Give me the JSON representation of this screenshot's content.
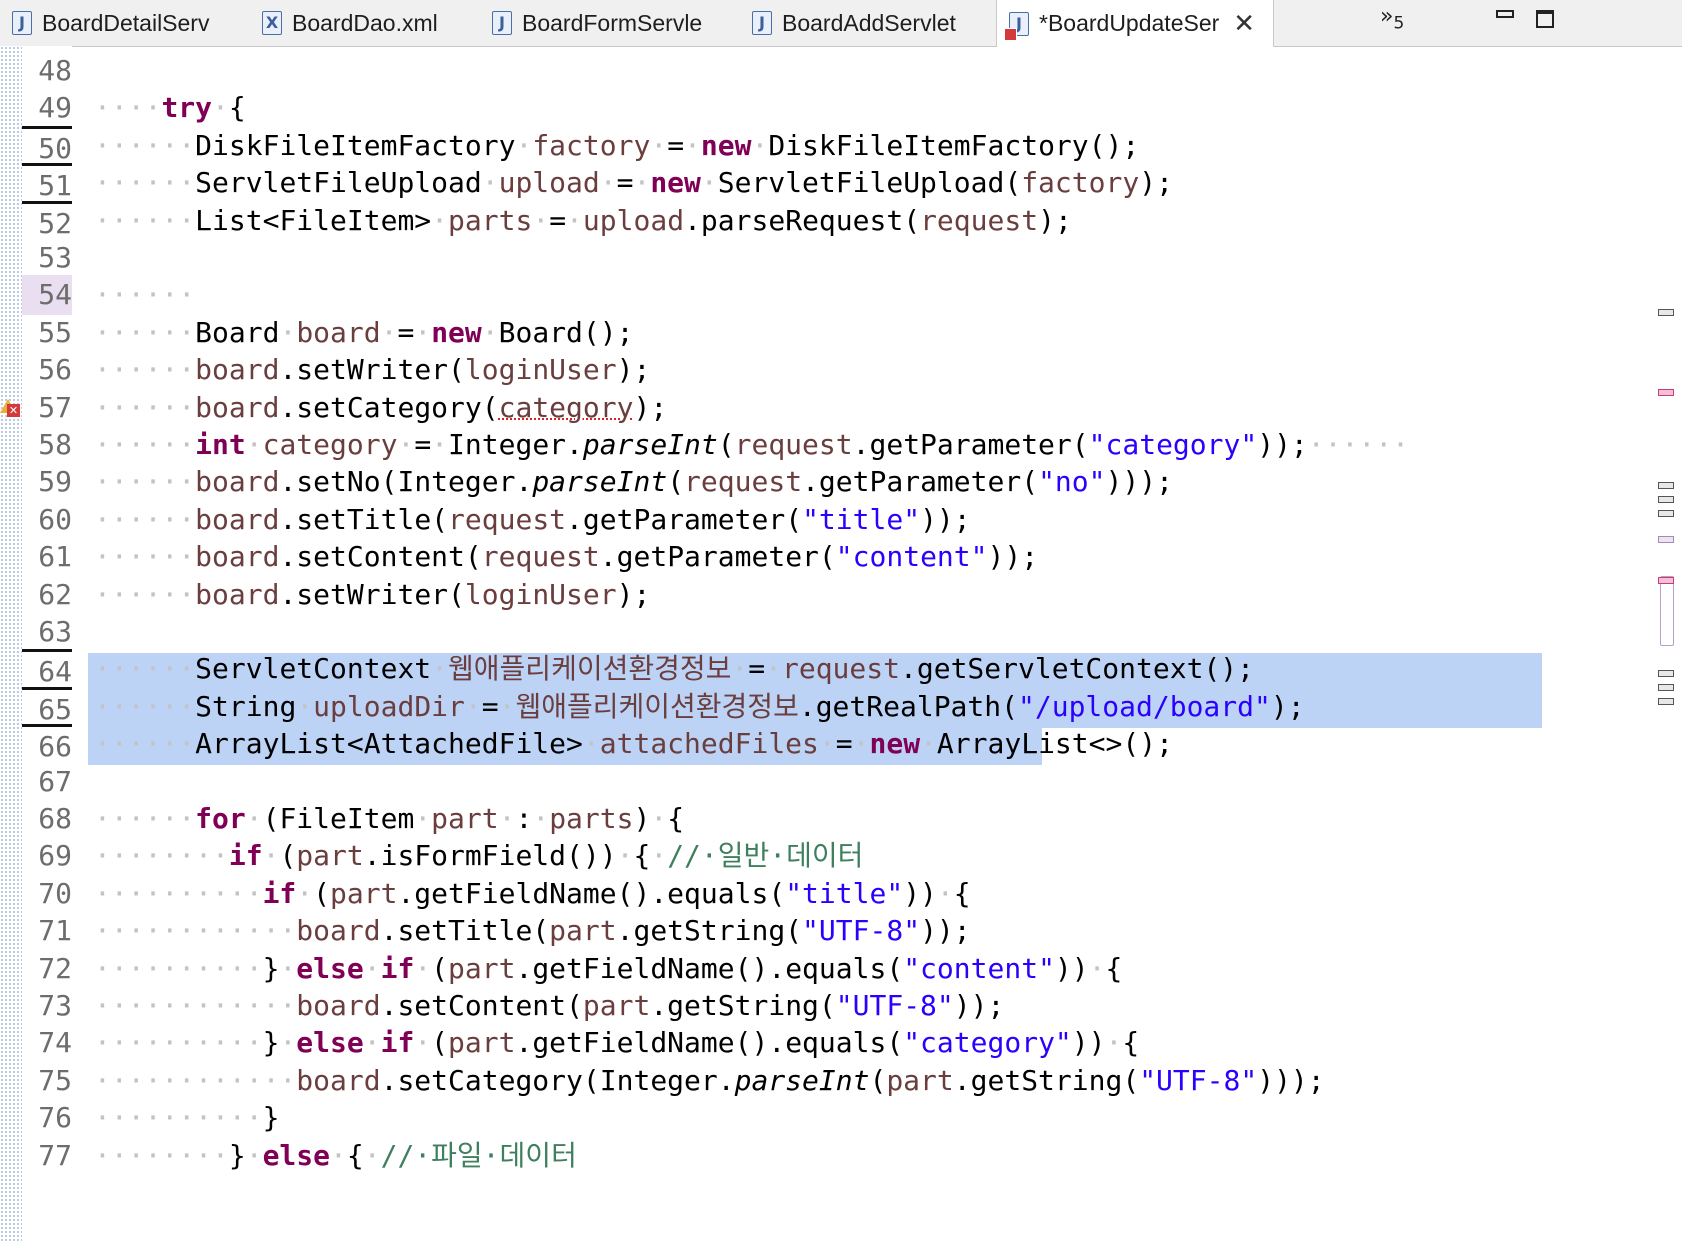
{
  "tabs": [
    {
      "label": "BoardDetailServ",
      "icon": "java-file-icon"
    },
    {
      "label": "BoardDao.xml",
      "icon": "xml-file-icon"
    },
    {
      "label": "BoardFormServle",
      "icon": "java-file-icon"
    },
    {
      "label": "BoardAddServlet",
      "icon": "java-file-icon"
    },
    {
      "label": "*BoardUpdateSer",
      "icon": "java-file-error-icon",
      "active": true
    }
  ],
  "tab_overflow": {
    "glyph": "»",
    "count": "5"
  },
  "editor": {
    "lines": [
      {
        "num": "48",
        "tokens": []
      },
      {
        "num": "49",
        "tokens": [
          [
            "ws",
            "····"
          ],
          [
            "kw",
            "try"
          ],
          [
            "ws",
            "·"
          ],
          [
            "p",
            "{"
          ]
        ]
      },
      {
        "num": "50",
        "breakpoint_mark": true,
        "tokens": [
          [
            "ws",
            "······"
          ],
          [
            "p",
            "DiskFileItemFactory"
          ],
          [
            "ws",
            "·"
          ],
          [
            "var",
            "factory"
          ],
          [
            "ws",
            "·"
          ],
          [
            "p",
            "="
          ],
          [
            "ws",
            "·"
          ],
          [
            "kw",
            "new"
          ],
          [
            "ws",
            "·"
          ],
          [
            "p",
            "DiskFileItemFactory();"
          ]
        ]
      },
      {
        "num": "51",
        "breakpoint_mark": true,
        "tokens": [
          [
            "ws",
            "······"
          ],
          [
            "p",
            "ServletFileUpload"
          ],
          [
            "ws",
            "·"
          ],
          [
            "var",
            "upload"
          ],
          [
            "ws",
            "·"
          ],
          [
            "p",
            "="
          ],
          [
            "ws",
            "·"
          ],
          [
            "kw",
            "new"
          ],
          [
            "ws",
            "·"
          ],
          [
            "p",
            "ServletFileUpload("
          ],
          [
            "var",
            "factory"
          ],
          [
            "p",
            ");"
          ]
        ]
      },
      {
        "num": "52",
        "breakpoint_mark": true,
        "tokens": [
          [
            "ws",
            "······"
          ],
          [
            "p",
            "List<FileItem>"
          ],
          [
            "ws",
            "·"
          ],
          [
            "var",
            "parts"
          ],
          [
            "ws",
            "·"
          ],
          [
            "p",
            "="
          ],
          [
            "ws",
            "·"
          ],
          [
            "var",
            "upload"
          ],
          [
            "p",
            ".parseRequest("
          ],
          [
            "var",
            "request"
          ],
          [
            "p",
            ");"
          ]
        ]
      },
      {
        "num": "53",
        "tokens": []
      },
      {
        "num": "54",
        "current": true,
        "tokens": [
          [
            "ws",
            "······"
          ]
        ]
      },
      {
        "num": "55",
        "tokens": [
          [
            "ws",
            "······"
          ],
          [
            "p",
            "Board"
          ],
          [
            "ws",
            "·"
          ],
          [
            "var",
            "board"
          ],
          [
            "ws",
            "·"
          ],
          [
            "p",
            "="
          ],
          [
            "ws",
            "·"
          ],
          [
            "kw",
            "new"
          ],
          [
            "ws",
            "·"
          ],
          [
            "p",
            "Board();"
          ]
        ]
      },
      {
        "num": "56",
        "tokens": [
          [
            "ws",
            "······"
          ],
          [
            "var",
            "board"
          ],
          [
            "p",
            ".setWriter("
          ],
          [
            "var",
            "loginUser"
          ],
          [
            "p",
            ");"
          ]
        ]
      },
      {
        "num": "57",
        "error": true,
        "tokens": [
          [
            "ws",
            "······"
          ],
          [
            "var",
            "board"
          ],
          [
            "p",
            ".setCategory("
          ],
          [
            "err",
            "category"
          ],
          [
            "p",
            ");"
          ]
        ]
      },
      {
        "num": "58",
        "tokens": [
          [
            "ws",
            "······"
          ],
          [
            "kw",
            "int"
          ],
          [
            "ws",
            "·"
          ],
          [
            "var",
            "category"
          ],
          [
            "ws",
            "·"
          ],
          [
            "p",
            "="
          ],
          [
            "ws",
            "·"
          ],
          [
            "p",
            "Integer."
          ],
          [
            "it",
            "parseInt"
          ],
          [
            "p",
            "("
          ],
          [
            "var",
            "request"
          ],
          [
            "p",
            ".getParameter("
          ],
          [
            "str",
            "\"category\""
          ],
          [
            "p",
            "));"
          ],
          [
            "ws",
            "······"
          ]
        ]
      },
      {
        "num": "59",
        "tokens": [
          [
            "ws",
            "······"
          ],
          [
            "var",
            "board"
          ],
          [
            "p",
            ".setNo(Integer."
          ],
          [
            "it",
            "parseInt"
          ],
          [
            "p",
            "("
          ],
          [
            "var",
            "request"
          ],
          [
            "p",
            ".getParameter("
          ],
          [
            "str",
            "\"no\""
          ],
          [
            "p",
            ")));"
          ]
        ]
      },
      {
        "num": "60",
        "tokens": [
          [
            "ws",
            "······"
          ],
          [
            "var",
            "board"
          ],
          [
            "p",
            ".setTitle("
          ],
          [
            "var",
            "request"
          ],
          [
            "p",
            ".getParameter("
          ],
          [
            "str",
            "\"title\""
          ],
          [
            "p",
            "));"
          ]
        ]
      },
      {
        "num": "61",
        "tokens": [
          [
            "ws",
            "······"
          ],
          [
            "var",
            "board"
          ],
          [
            "p",
            ".setContent("
          ],
          [
            "var",
            "request"
          ],
          [
            "p",
            ".getParameter("
          ],
          [
            "str",
            "\"content\""
          ],
          [
            "p",
            "));"
          ]
        ]
      },
      {
        "num": "62",
        "tokens": [
          [
            "ws",
            "······"
          ],
          [
            "var",
            "board"
          ],
          [
            "p",
            ".setWriter("
          ],
          [
            "var",
            "loginUser"
          ],
          [
            "p",
            ");"
          ]
        ]
      },
      {
        "num": "63",
        "tokens": []
      },
      {
        "num": "64",
        "breakpoint_mark": true,
        "tokens": [
          [
            "ws",
            "······"
          ],
          [
            "p",
            "ServletContext"
          ],
          [
            "ws",
            "·"
          ],
          [
            "var",
            "웹애플리케이션환경정보"
          ],
          [
            "ws",
            "·"
          ],
          [
            "p",
            "="
          ],
          [
            "ws",
            "·"
          ],
          [
            "var",
            "request"
          ],
          [
            "p",
            ".getServletContext();"
          ]
        ]
      },
      {
        "num": "65",
        "breakpoint_mark": true,
        "tokens": [
          [
            "ws",
            "······"
          ],
          [
            "p",
            "String"
          ],
          [
            "ws",
            "·"
          ],
          [
            "var",
            "uploadDir"
          ],
          [
            "ws",
            "·"
          ],
          [
            "p",
            "="
          ],
          [
            "ws",
            "·"
          ],
          [
            "var",
            "웹애플리케이션환경정보"
          ],
          [
            "p",
            ".getRealPath("
          ],
          [
            "str",
            "\"/upload/board\""
          ],
          [
            "p",
            ");"
          ]
        ]
      },
      {
        "num": "66",
        "breakpoint_mark": true,
        "tokens": [
          [
            "ws",
            "······"
          ],
          [
            "p",
            "ArrayList<AttachedFile>"
          ],
          [
            "ws",
            "·"
          ],
          [
            "var",
            "attachedFiles"
          ],
          [
            "ws",
            "·"
          ],
          [
            "p",
            "="
          ],
          [
            "ws",
            "·"
          ],
          [
            "kw",
            "new"
          ],
          [
            "ws",
            "·"
          ],
          [
            "p",
            "ArrayList<>();"
          ]
        ]
      },
      {
        "num": "67",
        "tokens": []
      },
      {
        "num": "68",
        "tokens": [
          [
            "ws",
            "······"
          ],
          [
            "kw",
            "for"
          ],
          [
            "ws",
            "·"
          ],
          [
            "p",
            "(FileItem"
          ],
          [
            "ws",
            "·"
          ],
          [
            "var",
            "part"
          ],
          [
            "ws",
            "·"
          ],
          [
            "p",
            ":"
          ],
          [
            "ws",
            "·"
          ],
          [
            "var",
            "parts"
          ],
          [
            "p",
            ")"
          ],
          [
            "ws",
            "·"
          ],
          [
            "p",
            "{"
          ]
        ]
      },
      {
        "num": "69",
        "tokens": [
          [
            "ws",
            "········"
          ],
          [
            "kw",
            "if"
          ],
          [
            "ws",
            "·"
          ],
          [
            "p",
            "("
          ],
          [
            "var",
            "part"
          ],
          [
            "p",
            ".isFormField())"
          ],
          [
            "ws",
            "·"
          ],
          [
            "p",
            "{"
          ],
          [
            "ws",
            "·"
          ],
          [
            "cmt",
            "//·일반·데이터"
          ]
        ]
      },
      {
        "num": "70",
        "tokens": [
          [
            "ws",
            "··········"
          ],
          [
            "kw",
            "if"
          ],
          [
            "ws",
            "·"
          ],
          [
            "p",
            "("
          ],
          [
            "var",
            "part"
          ],
          [
            "p",
            ".getFieldName().equals("
          ],
          [
            "str",
            "\"title\""
          ],
          [
            "p",
            "))"
          ],
          [
            "ws",
            "·"
          ],
          [
            "p",
            "{"
          ]
        ]
      },
      {
        "num": "71",
        "tokens": [
          [
            "ws",
            "············"
          ],
          [
            "var",
            "board"
          ],
          [
            "p",
            ".setTitle("
          ],
          [
            "var",
            "part"
          ],
          [
            "p",
            ".getString("
          ],
          [
            "str",
            "\"UTF-8\""
          ],
          [
            "p",
            "));"
          ]
        ]
      },
      {
        "num": "72",
        "tokens": [
          [
            "ws",
            "··········"
          ],
          [
            "p",
            "}"
          ],
          [
            "ws",
            "·"
          ],
          [
            "kw",
            "else"
          ],
          [
            "ws",
            "·"
          ],
          [
            "kw",
            "if"
          ],
          [
            "ws",
            "·"
          ],
          [
            "p",
            "("
          ],
          [
            "var",
            "part"
          ],
          [
            "p",
            ".getFieldName().equals("
          ],
          [
            "str",
            "\"content\""
          ],
          [
            "p",
            "))"
          ],
          [
            "ws",
            "·"
          ],
          [
            "p",
            "{"
          ]
        ]
      },
      {
        "num": "73",
        "tokens": [
          [
            "ws",
            "············"
          ],
          [
            "var",
            "board"
          ],
          [
            "p",
            ".setContent("
          ],
          [
            "var",
            "part"
          ],
          [
            "p",
            ".getString("
          ],
          [
            "str",
            "\"UTF-8\""
          ],
          [
            "p",
            "));"
          ]
        ]
      },
      {
        "num": "74",
        "tokens": [
          [
            "ws",
            "··········"
          ],
          [
            "p",
            "}"
          ],
          [
            "ws",
            "·"
          ],
          [
            "kw",
            "else"
          ],
          [
            "ws",
            "·"
          ],
          [
            "kw",
            "if"
          ],
          [
            "ws",
            "·"
          ],
          [
            "p",
            "("
          ],
          [
            "var",
            "part"
          ],
          [
            "p",
            ".getFieldName().equals("
          ],
          [
            "str",
            "\"category\""
          ],
          [
            "p",
            "))"
          ],
          [
            "ws",
            "·"
          ],
          [
            "p",
            "{"
          ]
        ]
      },
      {
        "num": "75",
        "tokens": [
          [
            "ws",
            "············"
          ],
          [
            "var",
            "board"
          ],
          [
            "p",
            ".setCategory(Integer."
          ],
          [
            "it",
            "parseInt"
          ],
          [
            "p",
            "("
          ],
          [
            "var",
            "part"
          ],
          [
            "p",
            ".getString("
          ],
          [
            "str",
            "\"UTF-8\""
          ],
          [
            "p",
            ")));"
          ]
        ]
      },
      {
        "num": "76",
        "tokens": [
          [
            "ws",
            "··········"
          ],
          [
            "p",
            "}"
          ]
        ]
      },
      {
        "num": "77",
        "tokens": [
          [
            "ws",
            "········"
          ],
          [
            "p",
            "}"
          ],
          [
            "ws",
            "·"
          ],
          [
            "kw",
            "else"
          ],
          [
            "ws",
            "·"
          ],
          [
            "p",
            "{"
          ],
          [
            "ws",
            "·"
          ],
          [
            "cmt",
            "//·파일·데이터"
          ]
        ]
      }
    ]
  },
  "colors": {
    "keyword": "#7f0055",
    "variable": "#6a3e3e",
    "string": "#2a00ff",
    "comment": "#3f7f5f",
    "selection": "#bdd3f5"
  }
}
